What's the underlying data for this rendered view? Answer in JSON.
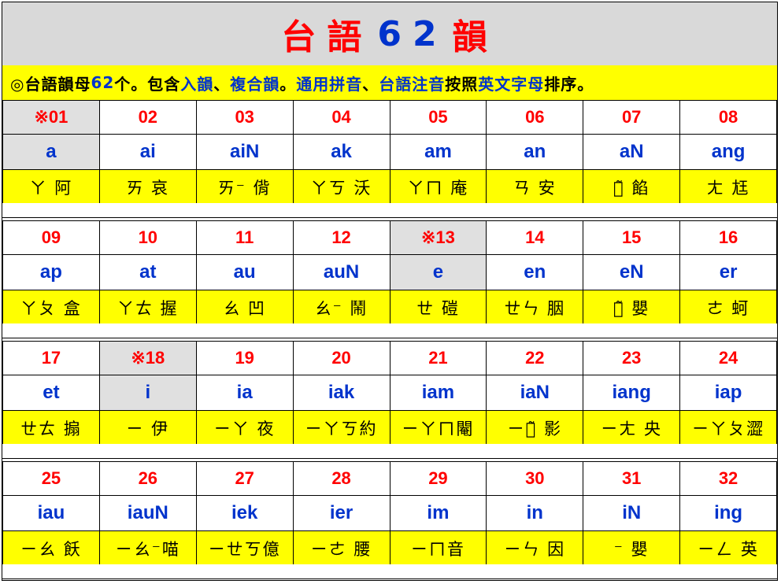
{
  "title": {
    "part1": "台語",
    "part2": "62",
    "part3": "韻"
  },
  "intro": [
    {
      "text": "◎台語韻母 ",
      "color": "black"
    },
    {
      "text": "62",
      "color": "blue"
    },
    {
      "text": "个。包含",
      "color": "black"
    },
    {
      "text": "入韻",
      "color": "blue"
    },
    {
      "text": "、",
      "color": "black"
    },
    {
      "text": "複合韻",
      "color": "blue"
    },
    {
      "text": "。",
      "color": "black"
    },
    {
      "text": "通用拼音",
      "color": "blue"
    },
    {
      "text": "、",
      "color": "black"
    },
    {
      "text": "台語注音",
      "color": "blue"
    },
    {
      "text": "按照",
      "color": "black"
    },
    {
      "text": "英文字母",
      "color": "blue"
    },
    {
      "text": "排序。",
      "color": "black"
    }
  ],
  "colors": {
    "red": "#ff0000",
    "blue": "#0033cc",
    "yellow": "#ffff00",
    "gray": "#e0e0e0"
  },
  "blocks": [
    {
      "cells": [
        {
          "num": "※01",
          "rom": "a",
          "zhu": "ㄚ 阿",
          "hl": true
        },
        {
          "num": "02",
          "rom": "ai",
          "zhu": "ㄞ 哀"
        },
        {
          "num": "03",
          "rom": "aiN",
          "zhu": "ㄞ⁻ 偝"
        },
        {
          "num": "04",
          "rom": "ak",
          "zhu": "ㄚㄎ 沃"
        },
        {
          "num": "05",
          "rom": "am",
          "zhu": "ㄚㄇ 庵"
        },
        {
          "num": "06",
          "rom": "an",
          "zhu": "ㄢ 安"
        },
        {
          "num": "07",
          "rom": "aN",
          "zhu": "ㄚ̃ 餡"
        },
        {
          "num": "08",
          "rom": "ang",
          "zhu": "ㄤ 尪"
        }
      ]
    },
    {
      "cells": [
        {
          "num": "09",
          "rom": "ap",
          "zhu": "ㄚㄆ 盒"
        },
        {
          "num": "10",
          "rom": "at",
          "zhu": "ㄚㄊ 握"
        },
        {
          "num": "11",
          "rom": "au",
          "zhu": "ㄠ 凹"
        },
        {
          "num": "12",
          "rom": "auN",
          "zhu": "ㄠ⁻ 鬧"
        },
        {
          "num": "※13",
          "rom": "e",
          "zhu": "ㄝ 磑",
          "hl": true
        },
        {
          "num": "14",
          "rom": "en",
          "zhu": "ㄝㄣ 胭"
        },
        {
          "num": "15",
          "rom": "eN",
          "zhu": "ㄝ̃ 嬰"
        },
        {
          "num": "16",
          "rom": "er",
          "zhu": "ㄜ 蚵"
        }
      ]
    },
    {
      "cells": [
        {
          "num": "17",
          "rom": "et",
          "zhu": "ㄝㄊ 搧"
        },
        {
          "num": "※18",
          "rom": "i",
          "zhu": "ㄧ 伊",
          "hl": true
        },
        {
          "num": "19",
          "rom": "ia",
          "zhu": "ㄧㄚ 夜"
        },
        {
          "num": "20",
          "rom": "iak",
          "zhu": "ㄧㄚㄎ約"
        },
        {
          "num": "21",
          "rom": "iam",
          "zhu": "ㄧㄚㄇ閹"
        },
        {
          "num": "22",
          "rom": "iaN",
          "zhu": "ㄧㄚ̃ 影"
        },
        {
          "num": "23",
          "rom": "iang",
          "zhu": "ㄧㄤ 央"
        },
        {
          "num": "24",
          "rom": "iap",
          "zhu": "ㄧㄚㄆ澀"
        }
      ]
    },
    {
      "cells": [
        {
          "num": "25",
          "rom": "iau",
          "zhu": "ㄧㄠ 飫"
        },
        {
          "num": "26",
          "rom": "iauN",
          "zhu": "ㄧㄠ⁻喵"
        },
        {
          "num": "27",
          "rom": "iek",
          "zhu": "ㄧㄝㄎ億"
        },
        {
          "num": "28",
          "rom": "ier",
          "zhu": "ㄧㄜ 腰"
        },
        {
          "num": "29",
          "rom": "im",
          "zhu": "ㄧㄇ音"
        },
        {
          "num": "30",
          "rom": "in",
          "zhu": "ㄧㄣ 因"
        },
        {
          "num": "31",
          "rom": "iN",
          "zhu": "⁻ 嬰"
        },
        {
          "num": "32",
          "rom": "ing",
          "zhu": "ㄧㄥ 英"
        }
      ]
    }
  ]
}
